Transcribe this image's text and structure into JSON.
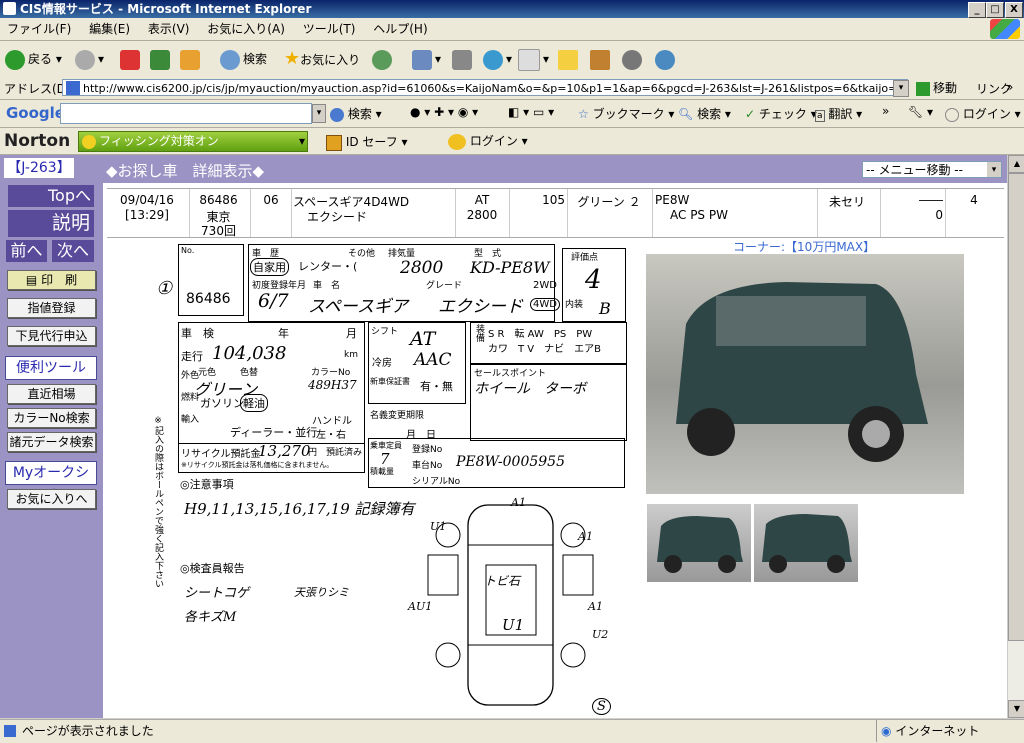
{
  "window": {
    "title": "CIS情報サービス - Microsoft Internet Explorer",
    "buttons": [
      "_",
      "□",
      "X"
    ]
  },
  "menu": [
    "ファイル(F)",
    "編集(E)",
    "表示(V)",
    "お気に入り(A)",
    "ツール(T)",
    "ヘルプ(H)"
  ],
  "toolbar": {
    "back": "戻る",
    "search": "検索",
    "favorites": "お気に入り"
  },
  "address": {
    "label": "アドレス(D)",
    "url": "http://www.cis6200.jp/cis/jp/myauction/myauction.asp?id=61060&s=KaijoNam&o=&p=10&p1=1&ap=6&pgcd=J-263&lst=J-261&listpos=6&tkaijo=TK&taa=730&ts",
    "go": "移動",
    "links": "リンク"
  },
  "google": {
    "logo": "Google",
    "search": "検索",
    "bookmarks": "ブックマーク",
    "search2": "検索",
    "check": "チェック",
    "translate": "翻訳",
    "login": "ログイン"
  },
  "norton": {
    "logo": "Norton",
    "phishing": "フィッシング対策オン",
    "idsafe": "ID セーフ",
    "login": "ログイン"
  },
  "page": {
    "code": "【J-263】",
    "heading": "◆お探し車　詳細表示◆",
    "menu_select": "-- メニュー移動 --",
    "sidebar": {
      "top": "Topへ",
      "explain": "説明",
      "prev": "前へ",
      "next": "次へ",
      "print": "印　刷",
      "bid": "指値登録",
      "proxy": "下見代行申込",
      "tools_header": "便利ツール",
      "market": "直近相場",
      "color_search": "カラーNo検索",
      "spec_search": "諸元データ検索",
      "my_header": "Myオークション",
      "favorites": "お気に入りへ"
    },
    "row": {
      "date": "09/04/16",
      "time": "[13:29]",
      "lot": "86486",
      "venue": "東京",
      "venue_no": "730回",
      "year": "06",
      "model": "スペースギア4D4WD",
      "grade": "エクシード",
      "shift": "AT",
      "cc": "2800",
      "mileage": "105",
      "color": "グリーン ２",
      "chassis": "PE8W",
      "equip": "AC PS PW",
      "status": "未セリ",
      "price_top": "――",
      "price": "0",
      "score": "4"
    },
    "corner": "コーナー:【10万円MAX】",
    "sheet": {
      "lot_label": "No.",
      "lot": "86486",
      "circle_num": "①",
      "type_label": "車　歴",
      "own_use": "自家用",
      "rental": "レンター・(",
      "other": "その他",
      "cc_label": "排気量",
      "cc_val": "2800",
      "model_label": "型　式",
      "model_val": "KD-PE8W",
      "score_label": "評価点",
      "score_val": "4",
      "first_reg": "初度登録年月",
      "reg_val": "6/7",
      "name_label": "車　名",
      "name_val": "スペースギア",
      "grade_label": "グレード",
      "grade_val": "エクシード",
      "drive2": "2WD",
      "drive4": "4WD",
      "interior": "内装",
      "interior_val": "B",
      "inspect": "車　検",
      "year_lbl": "年",
      "month_lbl": "月",
      "mileage_lbl": "走行",
      "mileage_val": "104,038",
      "km": "km",
      "shift_lbl": "シフト",
      "shift_val": "AT",
      "ac_lbl": "冷房",
      "ac_val": "AAC",
      "color_lbl": "外色",
      "orig_color": "元色",
      "color_change": "色替",
      "color_val": "グリーン",
      "color_no_lbl": "カラーNo",
      "color_no": "489H37",
      "fuel_lbl": "燃料",
      "fuel_gas": "ガソリン",
      "fuel_diesel": "軽油",
      "new_car": "新車保証書",
      "warranty": "有・無",
      "sales_point": "セールスポイント",
      "sales_val": "ホイール　ターボ",
      "equip_header": "装備",
      "equip1": "S R　転 AW　PS　PW",
      "equip2": "カワ　T V　ナビ　エアB",
      "import": "輸入",
      "dealer": "ディーラー・並行",
      "handle": "ハンドル",
      "handle_val": "左・右",
      "name_change": "名義変更期限",
      "month_day": "月　日",
      "recycle": "リサイクル預託金",
      "recycle_val": "13,270",
      "recycle_unit": "円　預託済み",
      "recycle_note": "※リサイクル預託金は落札価格に含まれません。",
      "capacity_lbl": "乗車定員",
      "capacity_val": "7",
      "load_lbl": "積載量",
      "reg_no": "登録No",
      "chassis_no_lbl": "車台No",
      "chassis_no": "PE8W-0005955",
      "serial": "シリアルNo",
      "notes_header": "◎注意事項",
      "notes_val": "H9,11,13,15,16,17,19 記録簿有",
      "inspector_header": "◎検査員報告",
      "insp1": "シートコゲ",
      "insp2": "天張りシミ",
      "insp3": "各キズM",
      "side_note": "※記入の際はボールペンで強く記入下さい",
      "diag_a1": "A1",
      "diag_u1": "U1",
      "diag_au1": "AU1",
      "diag_u2": "U2",
      "diag_center": "トビ石",
      "diag_mid": "U1",
      "diag_s": "S"
    }
  },
  "status": {
    "text": "ページが表示されました",
    "zone": "インターネット"
  }
}
